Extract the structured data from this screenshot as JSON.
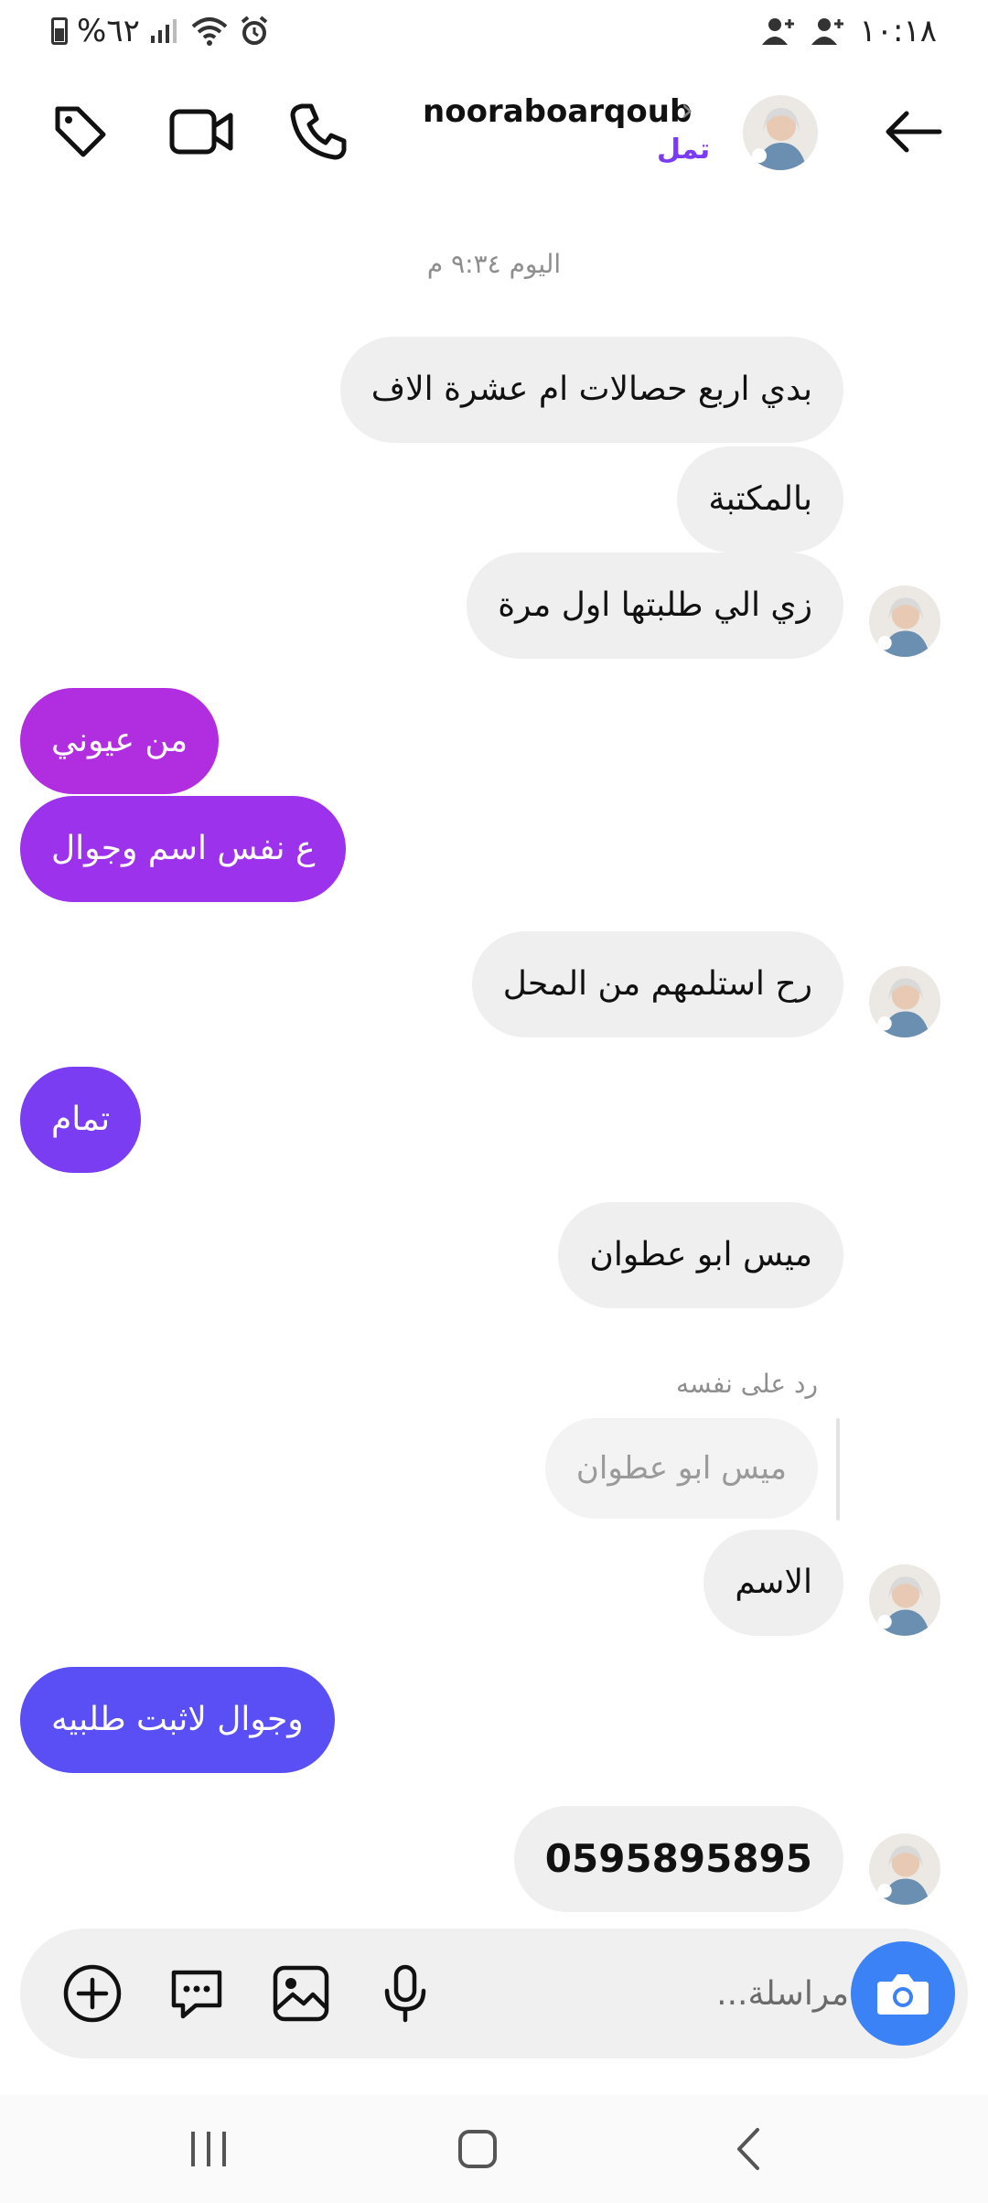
{
  "status_bar": {
    "battery": "%٦٢",
    "time": "١٠:١٨"
  },
  "header": {
    "username": "nooraboarqoub",
    "subtitle": "تمل",
    "icons": [
      "back-arrow-icon",
      "phone-icon",
      "video-camera-icon",
      "tag-icon"
    ]
  },
  "conversation": {
    "timestamp": "اليوم ٩:٣٤ م",
    "messages": [
      {
        "from": "them",
        "text": "بدي اربع حصالات ام عشرة الاف"
      },
      {
        "from": "them",
        "text": "بالمكتبة"
      },
      {
        "from": "them",
        "text": "زي الي طلبتها اول مرة"
      },
      {
        "from": "me",
        "text": "من عيوني"
      },
      {
        "from": "me",
        "text": "ع نفس اسم وجوال"
      },
      {
        "from": "them",
        "text": "رح استلمهم  من المحل"
      },
      {
        "from": "me",
        "text": "تمام"
      },
      {
        "from": "them",
        "text": "ميس ابو عطوان"
      },
      {
        "from": "them",
        "text": "الاسم"
      },
      {
        "from": "me",
        "text": "وجوال لاثبت طلبيه"
      },
      {
        "from": "them",
        "text": "0595895895"
      }
    ],
    "reply": {
      "label": "رد على نفسه",
      "quoted": "ميس ابو عطوان"
    }
  },
  "composer": {
    "placeholder": "مراسلة..."
  },
  "colors": {
    "out_bubble_1": "#b12ee0",
    "out_bubble_2": "#9c32ec",
    "out_bubble_3": "#7a3df2",
    "out_bubble_4": "#5a4ff5",
    "in_bubble": "#efefef",
    "camera_button": "#3b82f6",
    "subtitle": "#7a3cf0"
  }
}
